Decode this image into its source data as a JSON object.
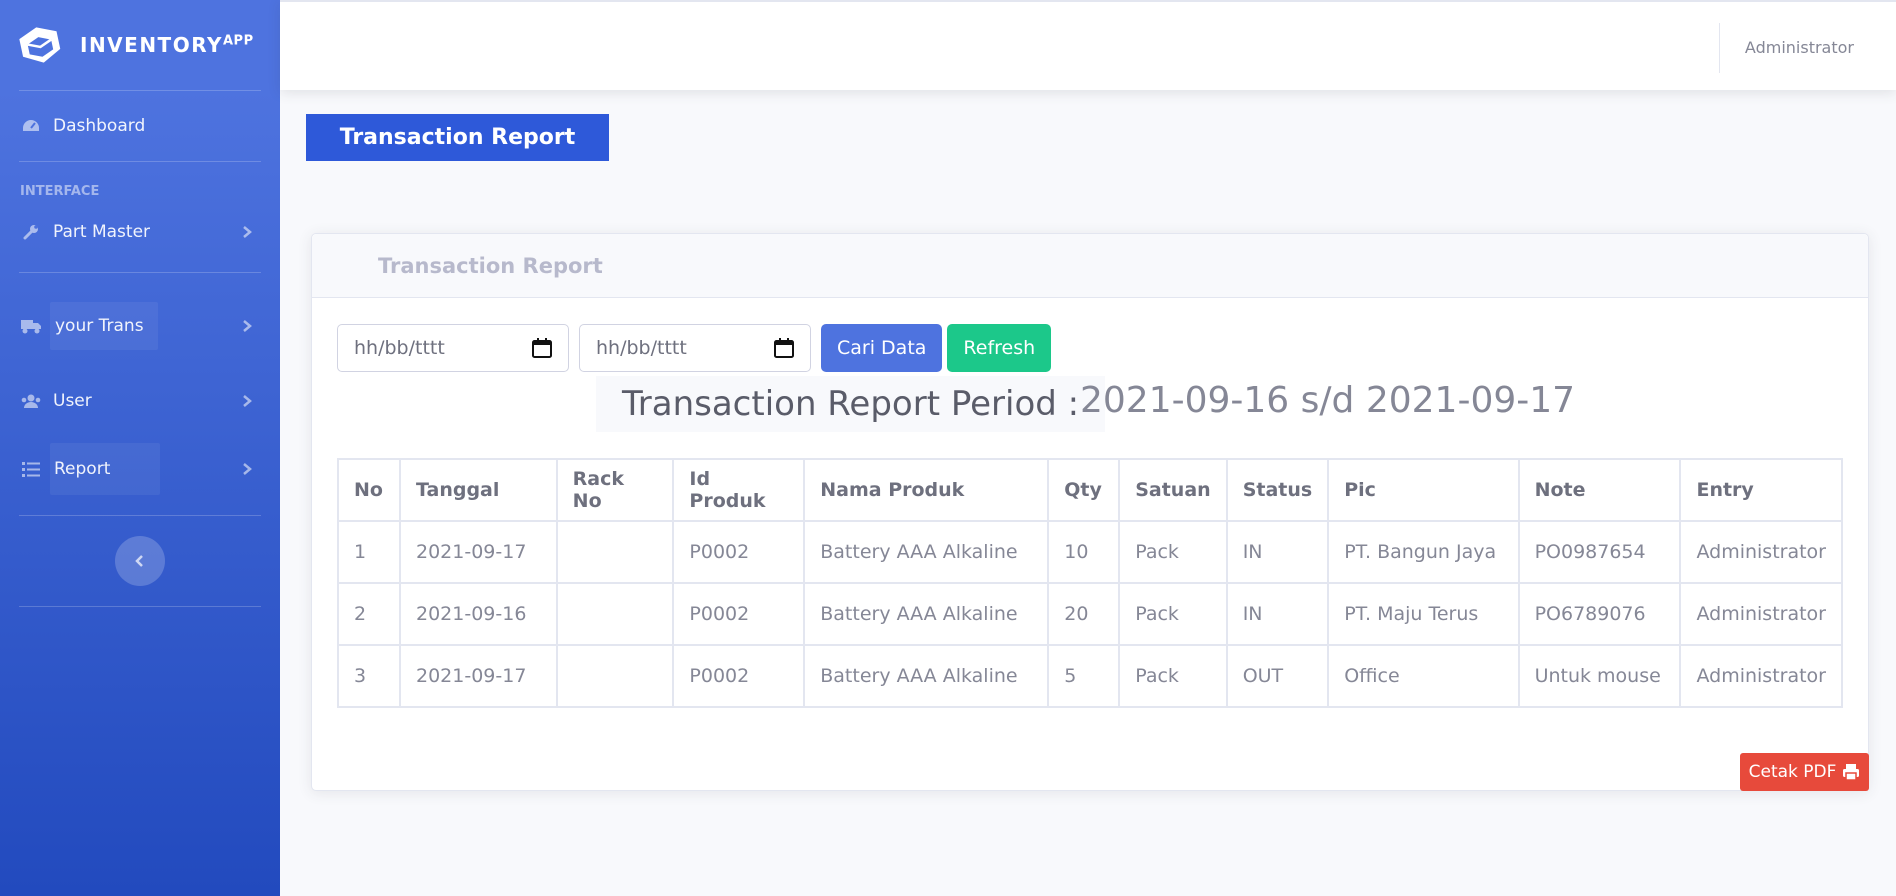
{
  "brand": {
    "name": "INVENTORY",
    "sup": "APP"
  },
  "sidebar": {
    "dashboard": "Dashboard",
    "section_heading": "INTERFACE",
    "items": [
      {
        "label": "Part Master",
        "icon": "wrench-icon"
      },
      {
        "label": "your Trans",
        "icon": "truck-icon"
      },
      {
        "label": "User",
        "icon": "users-icon"
      },
      {
        "label": "Report",
        "icon": "list-icon"
      }
    ]
  },
  "topbar": {
    "user": "Administrator"
  },
  "page": {
    "heading": "Transaction Report"
  },
  "card": {
    "title": "Transaction Report",
    "date_from_placeholder": "hh/bb/tttt",
    "date_to_placeholder": "hh/bb/tttt",
    "search_button": "Cari Data",
    "refresh_button": "Refresh",
    "period_label": "Transaction Report Period :",
    "period_value": "2021-09-16 s/d 2021-09-17",
    "print_button": "Cetak PDF"
  },
  "table": {
    "headers": [
      "No",
      "Tanggal",
      "Rack No",
      "Id Produk",
      "Nama Produk",
      "Qty",
      "Satuan",
      "Status",
      "Pic",
      "Note",
      "Entry"
    ],
    "rows": [
      [
        "1",
        "2021-09-17",
        "",
        "P0002",
        "Battery AAA Alkaline",
        "10",
        "Pack",
        "IN",
        "PT. Bangun Jaya",
        "PO0987654",
        "Administrator"
      ],
      [
        "2",
        "2021-09-16",
        "",
        "P0002",
        "Battery AAA Alkaline",
        "20",
        "Pack",
        "IN",
        "PT. Maju Terus",
        "PO6789076",
        "Administrator"
      ],
      [
        "3",
        "2021-09-17",
        "",
        "P0002",
        "Battery AAA Alkaline",
        "5",
        "Pack",
        "OUT",
        "Office",
        "Untuk mouse",
        "Administrator"
      ]
    ]
  },
  "colors": {
    "sidebar_top": "#4e73df",
    "sidebar_bottom": "#224abe",
    "primary": "#4e73df",
    "success": "#1cc88a",
    "danger": "#e74a3b"
  }
}
